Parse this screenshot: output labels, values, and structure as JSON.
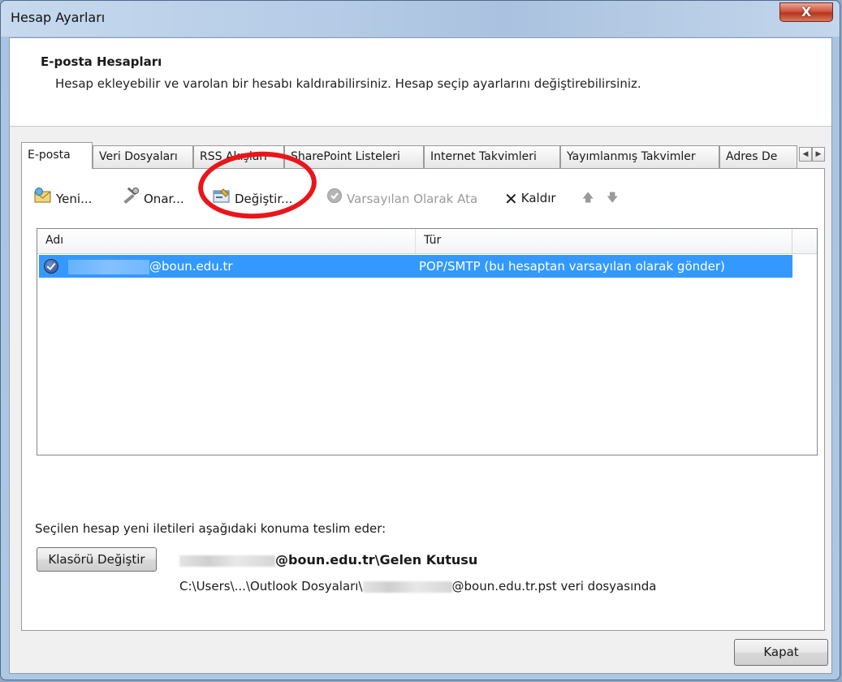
{
  "window": {
    "title": "Hesap Ayarları",
    "close_glyph": "X"
  },
  "header": {
    "title": "E-posta Hesapları",
    "description": "Hesap ekleyebilir ve varolan bir hesabı kaldırabilirsiniz. Hesap seçip ayarlarını değiştirebilirsiniz."
  },
  "tabs": [
    {
      "label": "E-posta",
      "active": true
    },
    {
      "label": "Veri Dosyaları"
    },
    {
      "label": "RSS Akışları"
    },
    {
      "label": "SharePoint Listeleri"
    },
    {
      "label": "Internet Takvimleri"
    },
    {
      "label": "Yayımlanmış Takvimler"
    },
    {
      "label": "Adres De"
    }
  ],
  "tab_scroll": {
    "left": "◀",
    "right": "▶"
  },
  "toolbar": {
    "new_label": "Yeni...",
    "repair_label": "Onar...",
    "change_label": "Değiştir...",
    "set_default_label": "Varsayılan Olarak Ata",
    "remove_label": "Kaldır",
    "remove_glyph": "✕",
    "up_glyph": "🡅",
    "down_glyph": "🡇"
  },
  "list": {
    "columns": [
      "Adı",
      "Tür"
    ],
    "rows": [
      {
        "name_suffix": "@boun.edu.tr",
        "type": "POP/SMTP (bu hesaptan varsayılan olarak gönder)"
      }
    ]
  },
  "delivery": {
    "label": "Seçilen hesap yeni iletileri aşağıdaki konuma teslim eder:",
    "folder_button": "Klasörü Değiştir",
    "location_suffix": "@boun.edu.tr\\Gelen Kutusu",
    "path_prefix": "C:\\Users\\...\\Outlook Dosyaları\\",
    "path_suffix": "@boun.edu.tr.pst veri dosyasında"
  },
  "footer": {
    "close_label": "Kapat"
  },
  "colors": {
    "selection": "#3399ff",
    "highlight_ring": "#e8161b"
  }
}
